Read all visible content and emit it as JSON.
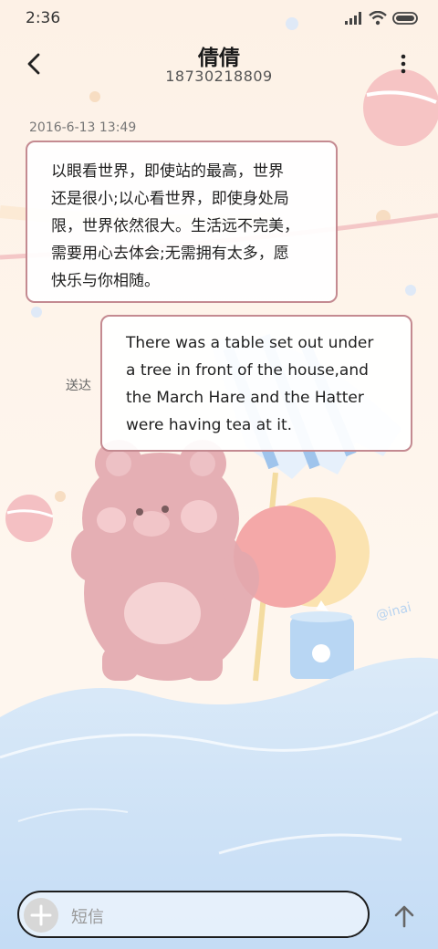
{
  "status_bar": {
    "time": "2:36",
    "icons": [
      "signal-icon",
      "wifi-icon",
      "battery-icon"
    ]
  },
  "header": {
    "contact_name": "倩倩",
    "phone_number": "18730218809"
  },
  "messages": [
    {
      "direction": "incoming",
      "timestamp": "2016-6-13 13:49",
      "lines": [
        "以眼看世界，即使站的最高，世界",
        "还是很小;以心看世界，即使身处局",
        "限，世界依然很大。生活远不完美，",
        "需要用心去体会;无需拥有太多，愿",
        "快乐与你相随。"
      ]
    },
    {
      "direction": "outgoing",
      "status": "送达",
      "lines": [
        "There was a table set out under",
        "a tree in front of the house,and",
        "the March Hare and the Hatter",
        "were having tea at it."
      ]
    }
  ],
  "composer": {
    "placeholder": "短信"
  },
  "wallpaper": {
    "watermark": "@inai"
  },
  "colors": {
    "bubble_border": "#c48a91",
    "bear": "#e3a8ae",
    "sea": "#cfe3f7"
  }
}
